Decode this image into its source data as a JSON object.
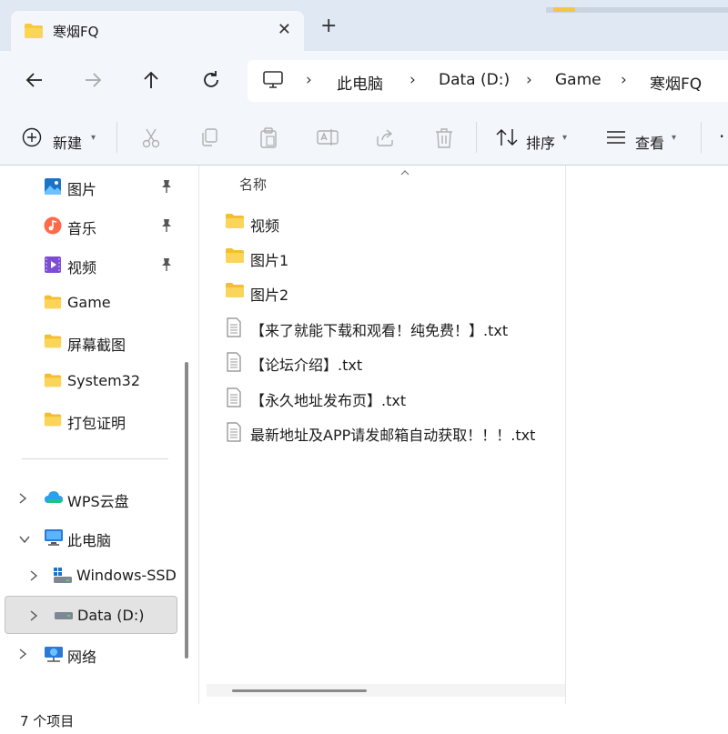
{
  "tab": {
    "title": "寒烟FQ",
    "close_glyph": "✕",
    "new_glyph": "+"
  },
  "breadcrumb": {
    "items": [
      "此电脑",
      "Data (D:)",
      "Game",
      "寒烟FQ"
    ],
    "separator": "›"
  },
  "commands": {
    "new_label": "新建",
    "sort_label": "排序",
    "view_label": "查看",
    "more_glyph": "·"
  },
  "sidebar": {
    "items": [
      {
        "label": "图片",
        "icon": "pictures-icon",
        "pinned": true
      },
      {
        "label": "音乐",
        "icon": "music-icon",
        "pinned": true
      },
      {
        "label": "视频",
        "icon": "videos-icon",
        "pinned": true
      },
      {
        "label": "Game",
        "icon": "folder-icon"
      },
      {
        "label": "屏幕截图",
        "icon": "folder-icon"
      },
      {
        "label": "System32",
        "icon": "folder-icon"
      },
      {
        "label": "打包证明",
        "icon": "folder-icon"
      },
      {
        "label": "WPS云盘",
        "icon": "cloud-icon",
        "expanded": false
      },
      {
        "label": "此电脑",
        "icon": "computer-icon",
        "expanded": true
      },
      {
        "label": "Windows-SSD",
        "icon": "drive-icon",
        "expanded": false
      },
      {
        "label": "Data (D:)",
        "icon": "drive-icon",
        "expanded": false,
        "selected": true
      },
      {
        "label": "网络",
        "icon": "network-icon",
        "expanded": false
      }
    ]
  },
  "content": {
    "column_header": "名称",
    "files": [
      {
        "name": "视频",
        "type": "folder"
      },
      {
        "name": "图片1",
        "type": "folder"
      },
      {
        "name": "图片2",
        "type": "folder"
      },
      {
        "name": "【来了就能下载和观看！纯免费！】.txt",
        "type": "txt"
      },
      {
        "name": "【论坛介绍】.txt",
        "type": "txt"
      },
      {
        "name": "【永久地址发布页】.txt",
        "type": "txt"
      },
      {
        "name": "最新地址及APP请发邮箱自动获取！！！.txt",
        "type": "txt"
      }
    ]
  },
  "status": {
    "item_count": "7 个项目"
  },
  "colors": {
    "accent": "#0067c0",
    "folder": "#f8c93d",
    "chrome": "#f3f6fb",
    "titlebar": "#dfe8f3"
  }
}
